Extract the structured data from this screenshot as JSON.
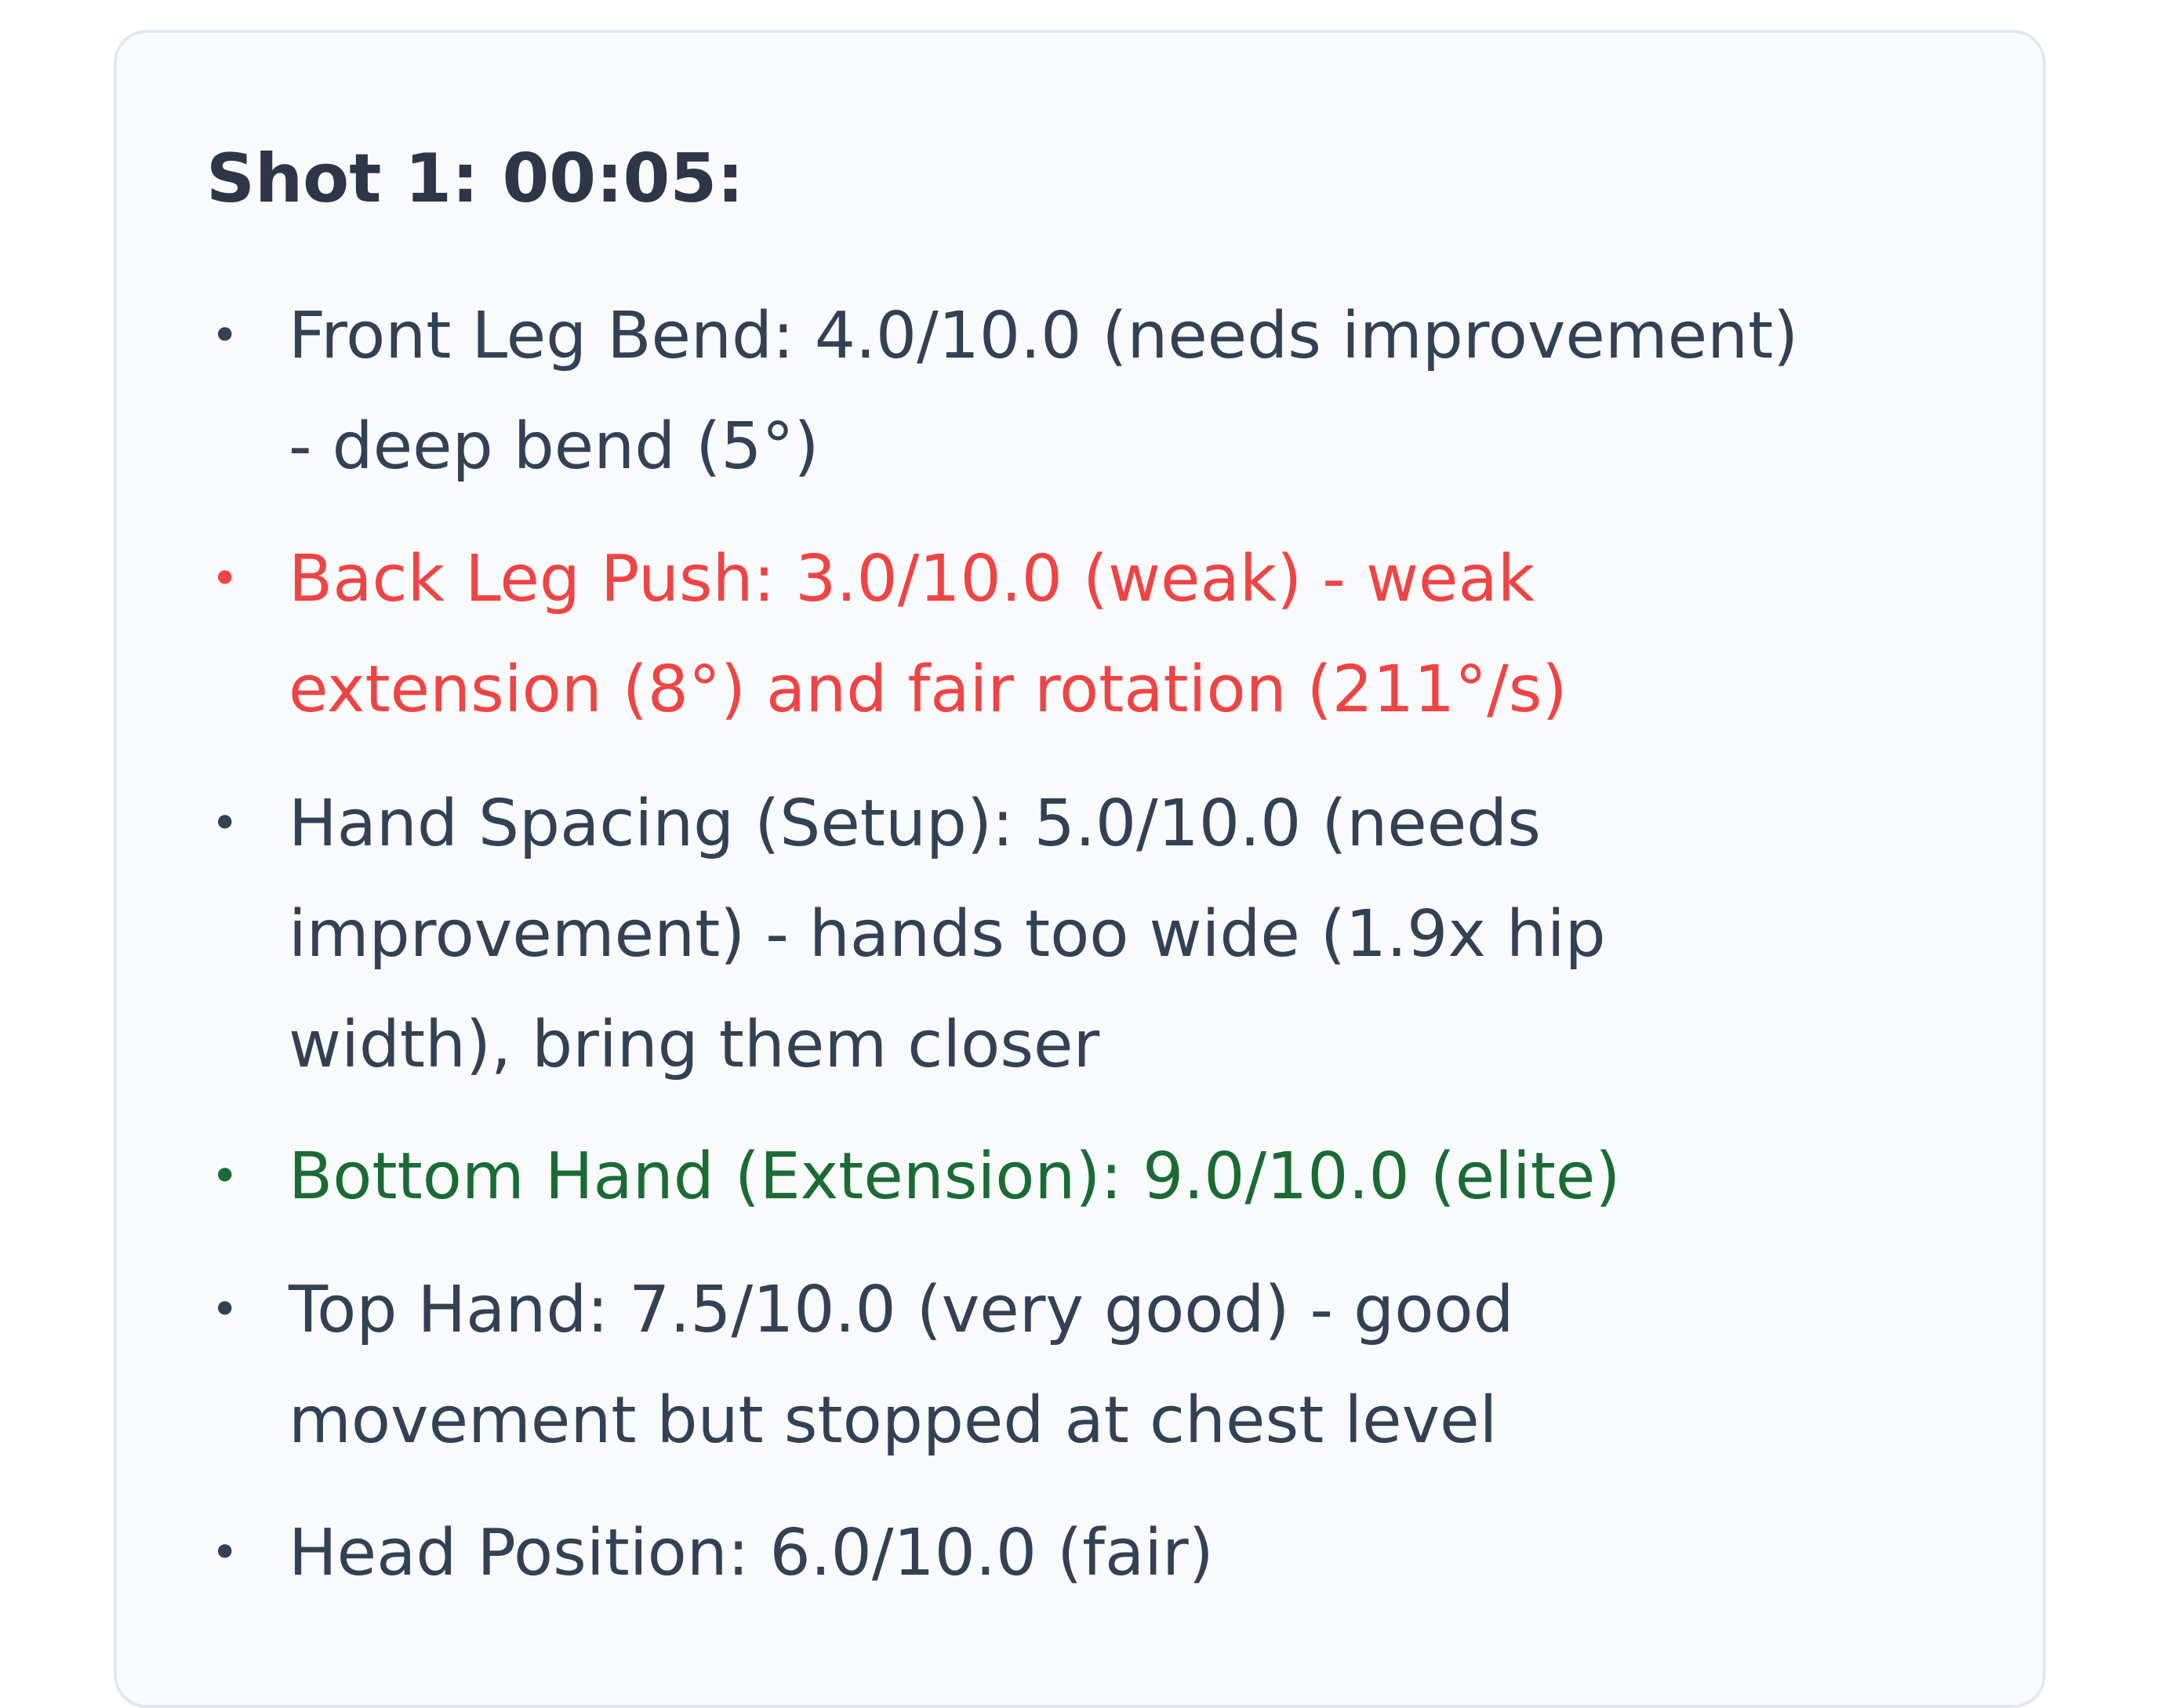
{
  "shot": {
    "title": "Shot 1: 00:05:",
    "bullet_glyph": "•",
    "colors": {
      "default": "#334155",
      "warning": "#ef4444",
      "success": "#1a6b34"
    },
    "items": [
      {
        "status": "default",
        "lines": [
          "Front Leg Bend: 4.0/10.0 (needs improvement)",
          "- deep bend (5°)"
        ]
      },
      {
        "status": "warning",
        "lines": [
          "Back Leg Push: 3.0/10.0 (weak) - weak",
          "extension (8°) and fair rotation (211°/s)"
        ]
      },
      {
        "status": "default",
        "lines": [
          "Hand Spacing (Setup): 5.0/10.0 (needs",
          "improvement) - hands too wide (1.9x hip",
          "width), bring them closer"
        ]
      },
      {
        "status": "success",
        "lines": [
          "Bottom Hand (Extension): 9.0/10.0 (elite)"
        ]
      },
      {
        "status": "default",
        "lines": [
          "Top Hand: 7.5/10.0 (very good) - good",
          "movement but stopped at chest level"
        ]
      },
      {
        "status": "default",
        "lines": [
          "Head Position: 6.0/10.0 (fair)"
        ]
      }
    ]
  }
}
